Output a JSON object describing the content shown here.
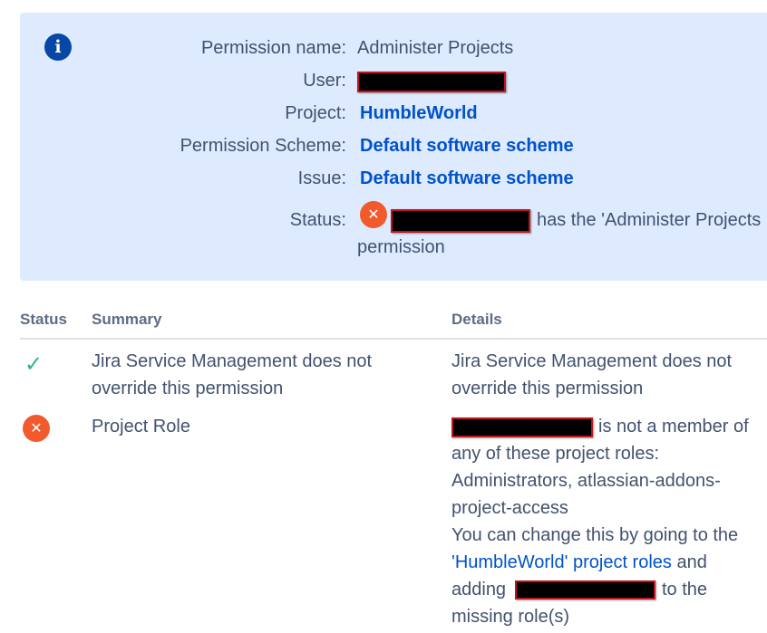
{
  "info": {
    "permission_name_label": "Permission name:",
    "permission_name_value": "Administer Projects",
    "user_label": "User:",
    "project_label": "Project:",
    "project_value": "HumbleWorld",
    "scheme_label": "Permission Scheme:",
    "scheme_value": "Default software scheme",
    "issue_label": "Issue:",
    "issue_value": "Default software scheme",
    "status_label": "Status:",
    "status_text_line1": "has the 'Administer Projects",
    "status_text_line2": "permission"
  },
  "table": {
    "headers": {
      "status": "Status",
      "summary": "Summary",
      "details": "Details"
    },
    "rows": [
      {
        "status": "success",
        "summary_line1": "Jira Service Management does not",
        "summary_line2": "override this permission",
        "details_line1": "Jira Service Management does not",
        "details_line2": "override this permission"
      },
      {
        "status": "error",
        "summary": "Project Role",
        "details": {
          "line1_suffix": "is not a member of",
          "line2": "any of these project roles:",
          "line3": "Administrators, atlassian-addons-",
          "line4": "project-access",
          "line5": "You can change this by going to the",
          "link": "'HumbleWorld' project roles",
          "link_suffix": " and",
          "line7_prefix": "adding",
          "line7_suffix": "to the",
          "line8": "missing role(s)"
        }
      }
    ]
  },
  "colors": {
    "panel_bg": "#deebff",
    "link": "#0052cc",
    "error": "#f15a2c",
    "success": "#36b37e",
    "info": "#0747a6"
  },
  "icons": {
    "info": "info-icon",
    "error": "error-icon",
    "success": "checkmark-icon"
  }
}
